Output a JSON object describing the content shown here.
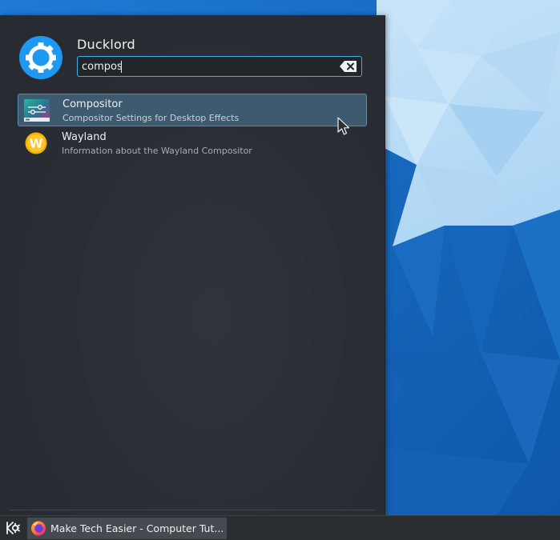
{
  "launcher": {
    "user_name": "Ducklord",
    "search": {
      "value": "compos",
      "placeholder": ""
    },
    "results": [
      {
        "title": "Compositor",
        "subtitle": "Compositor Settings for Desktop Effects",
        "icon": "compositor-settings-icon",
        "selected": true
      },
      {
        "title": "Wayland",
        "subtitle": "Information about the Wayland Compositor",
        "icon": "wayland-icon",
        "selected": false
      }
    ]
  },
  "taskbar": {
    "launcher_icon": "kde-logo-icon",
    "tasks": [
      {
        "label": "Make Tech Easier - Computer Tut...",
        "icon": "firefox-icon"
      }
    ]
  },
  "colors": {
    "accent": "#3daee9",
    "panel_bg": "#2a2e34",
    "selection_bg": "#3d5a6e",
    "wallpaper_blue": "#1d6fc4",
    "wallpaper_light": "#b9dcf5"
  }
}
